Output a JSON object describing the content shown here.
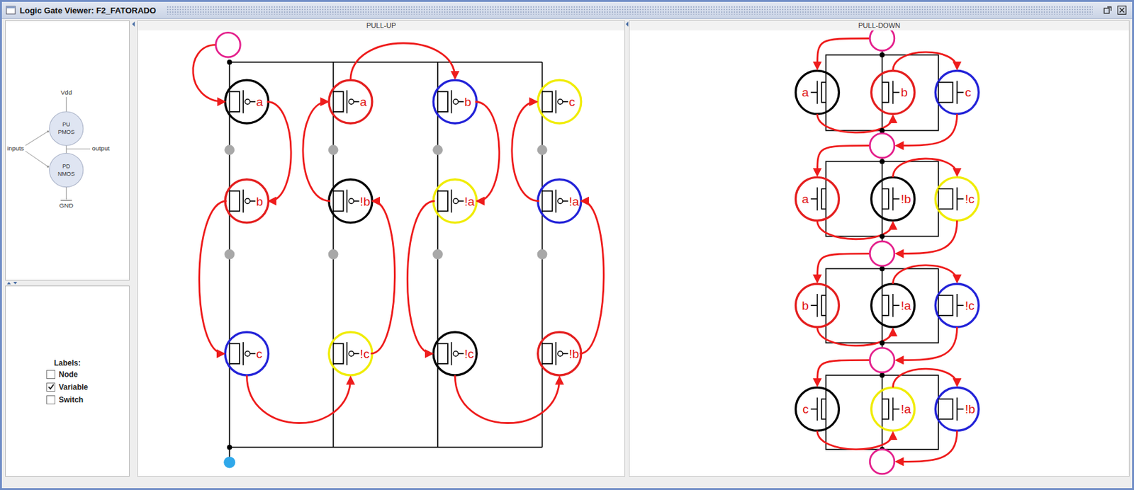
{
  "window": {
    "title": "Logic Gate Viewer: F2_FATORADO"
  },
  "schematic": {
    "supply": "Vdd",
    "ground": "GND",
    "inputs": "inputs",
    "output": "output",
    "pull_up": {
      "line1": "PU",
      "line2": "PMOS"
    },
    "pull_down": {
      "line1": "PD",
      "line2": "NMOS"
    }
  },
  "labels_panel": {
    "title": "Labels:",
    "options": [
      {
        "label": "Node",
        "checked": false
      },
      {
        "label": "Variable",
        "checked": true
      },
      {
        "label": "Switch",
        "checked": false
      }
    ]
  },
  "pull_up": {
    "title": "PULL-UP",
    "columns": [
      {
        "transistors": [
          {
            "label": "a",
            "color": "#000000"
          },
          {
            "label": "b",
            "color": "#e41f1f"
          },
          {
            "label": "c",
            "color": "#2323d8"
          }
        ]
      },
      {
        "transistors": [
          {
            "label": "a",
            "color": "#e41f1f"
          },
          {
            "label": "!b",
            "color": "#000000"
          },
          {
            "label": "!c",
            "color": "#f0ec00"
          }
        ]
      },
      {
        "transistors": [
          {
            "label": "b",
            "color": "#2323d8"
          },
          {
            "label": "!a",
            "color": "#f0ec00"
          },
          {
            "label": "!c",
            "color": "#000000"
          }
        ]
      },
      {
        "transistors": [
          {
            "label": "c",
            "color": "#f0ec00"
          },
          {
            "label": "!a",
            "color": "#2323d8"
          },
          {
            "label": "!b",
            "color": "#e41f1f"
          }
        ]
      }
    ]
  },
  "pull_down": {
    "title": "PULL-DOWN",
    "groups": [
      {
        "transistors": [
          {
            "label": "a",
            "color": "#000000"
          },
          {
            "label": "b",
            "color": "#e41f1f"
          },
          {
            "label": "c",
            "color": "#2323d8"
          }
        ]
      },
      {
        "transistors": [
          {
            "label": "a",
            "color": "#e41f1f"
          },
          {
            "label": "!b",
            "color": "#000000"
          },
          {
            "label": "!c",
            "color": "#f0ec00"
          }
        ]
      },
      {
        "transistors": [
          {
            "label": "b",
            "color": "#e41f1f"
          },
          {
            "label": "!a",
            "color": "#000000"
          },
          {
            "label": "!c",
            "color": "#2323d8"
          }
        ]
      },
      {
        "transistors": [
          {
            "label": "c",
            "color": "#000000"
          },
          {
            "label": "!a",
            "color": "#f0ec00"
          },
          {
            "label": "!b",
            "color": "#2323d8"
          }
        ]
      }
    ]
  }
}
